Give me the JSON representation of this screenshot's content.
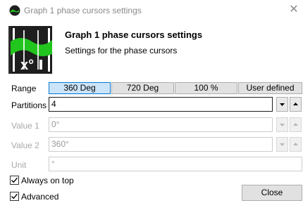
{
  "window": {
    "title": "Graph 1 phase cursors settings"
  },
  "header": {
    "title": "Graph 1 phase cursors settings",
    "subtitle": "Settings for the phase cursors"
  },
  "range": {
    "label": "Range",
    "options": [
      "360 Deg",
      "720 Deg",
      "100 %",
      "User defined"
    ],
    "selected": "360 Deg"
  },
  "partitions": {
    "label": "Partitions",
    "value": "4"
  },
  "value1": {
    "label": "Value 1",
    "value": "0°"
  },
  "value2": {
    "label": "Value 2",
    "value": "360°"
  },
  "unit": {
    "label": "Unit",
    "value": "°"
  },
  "always_on_top": {
    "label": "Always on top",
    "checked": true
  },
  "advanced": {
    "label": "Advanced",
    "checked": true
  },
  "close_button": {
    "label": "Close"
  },
  "colors": {
    "accent": "#0078d7",
    "icon_green": "#22c41e",
    "icon_dark": "#1e1e1e"
  }
}
